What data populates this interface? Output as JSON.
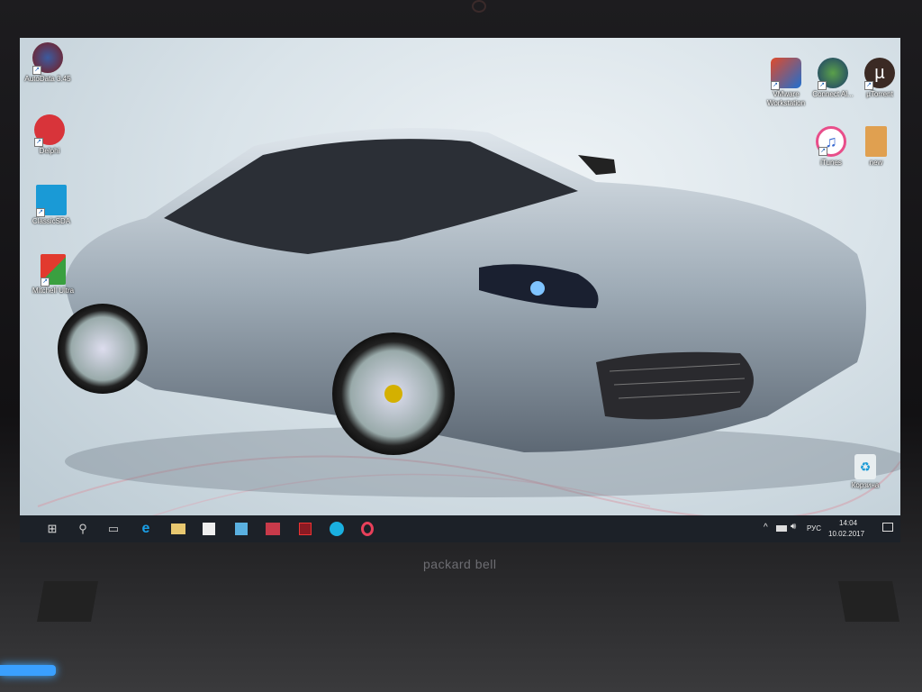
{
  "desktop": {
    "left_icons": [
      {
        "label": "AutoData 3.45",
        "icon": "autodata-icon",
        "color": "#c0392b"
      },
      {
        "label": "Delphi",
        "icon": "engine-check-icon",
        "color": "#d8343a"
      },
      {
        "label": "ClassicSDA",
        "icon": "car-service-icon",
        "color": "#1a9ad6"
      },
      {
        "label": "Mitchell Ultra",
        "icon": "mitchell-icon",
        "color": "#e23a2e"
      }
    ],
    "right_icons": [
      {
        "label": "VMware Workstation",
        "icon": "vmware-icon",
        "color": "#1f6fd0"
      },
      {
        "label": "Connect Al...",
        "icon": "connect-icon",
        "color": "#2b7a3a"
      },
      {
        "label": "µTorrent",
        "icon": "utorrent-icon",
        "color": "#3b2a24"
      },
      {
        "label": "iTunes",
        "icon": "itunes-icon",
        "color": "#e84e8a"
      },
      {
        "label": "new",
        "icon": "folder-icon",
        "color": "#e0a050"
      }
    ],
    "recycle_bin": {
      "label": "Корзина",
      "icon": "recycle-bin-icon"
    }
  },
  "taskbar": {
    "buttons": [
      {
        "name": "start",
        "icon": "windows-start-icon"
      },
      {
        "name": "search",
        "icon": "search-icon"
      },
      {
        "name": "task-view",
        "icon": "task-view-icon"
      },
      {
        "name": "edge",
        "icon": "edge-icon"
      },
      {
        "name": "file-explorer",
        "icon": "folder-icon"
      },
      {
        "name": "store",
        "icon": "store-icon"
      },
      {
        "name": "media-player",
        "icon": "media-player-icon"
      },
      {
        "name": "app-64",
        "icon": "app-64-icon"
      },
      {
        "name": "acrobat",
        "icon": "acrobat-icon"
      },
      {
        "name": "skype",
        "icon": "skype-icon"
      },
      {
        "name": "opera",
        "icon": "opera-icon"
      }
    ],
    "tray": {
      "language": "РУС",
      "time": "14:04",
      "date": "10.02.2017"
    }
  },
  "bezel": {
    "brand": "packard bell"
  }
}
